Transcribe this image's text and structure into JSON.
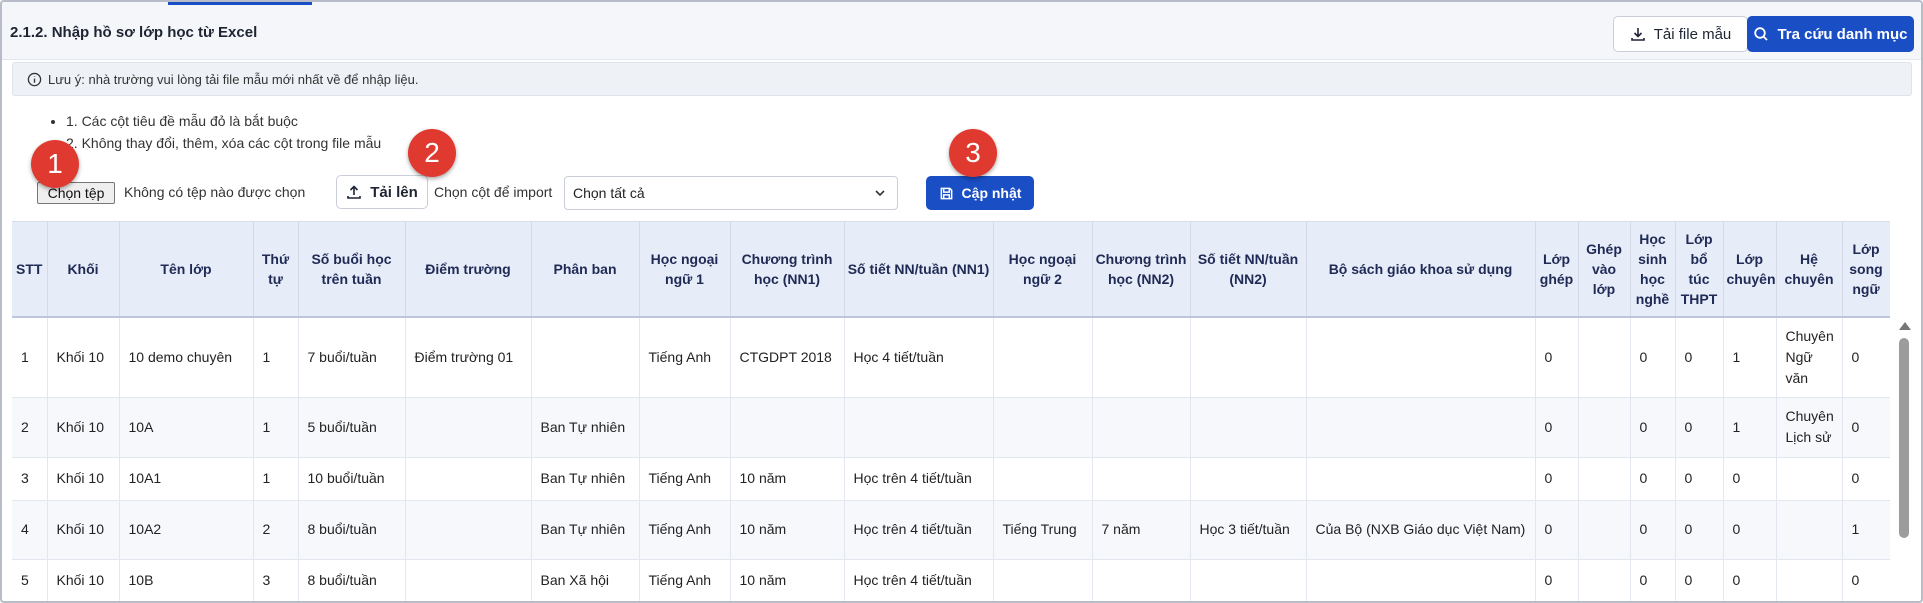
{
  "header": {
    "title": "2.1.2. Nhập hồ sơ lớp học từ Excel",
    "download_label": "Tải file mẫu",
    "lookup_label": "Tra cứu danh mục"
  },
  "note": {
    "text": "Lưu ý: nhà trường vui lòng tải file mẫu mới nhất về để nhập liệu."
  },
  "rules": [
    "1. Các cột tiêu đề mẫu đỏ là bắt buộc",
    "2. Không thay đổi, thêm, xóa các cột trong file mẫu"
  ],
  "toolbar": {
    "file_button": "Chọn tệp",
    "file_status": "Không có tệp nào được chọn",
    "upload_label": "Tải lên",
    "column_label": "Chọn cột để import",
    "column_select_value": "Chọn tất cả",
    "update_label": "Cập nhật"
  },
  "markers": [
    "1",
    "2",
    "3"
  ],
  "colors": {
    "primary": "#1a4ec4",
    "marker": "#e0392f",
    "header_bg": "#e6ecf8"
  },
  "table": {
    "headers": [
      "STT",
      "Khối",
      "Tên lớp",
      "Thứ tự",
      "Số buổi học trên tuần",
      "Điểm trường",
      "Phân ban",
      "Học ngoại ngữ 1",
      "Chương trình học (NN1)",
      "Số tiết NN/tuần (NN1)",
      "Học ngoại ngữ 2",
      "Chương trình học (NN2)",
      "Số tiết NN/tuần (NN2)",
      "Bộ sách giáo khoa sử dụng",
      "Lớp ghép",
      "Ghép vào lớp",
      "Học sinh học nghề",
      "Lớp bổ túc THPT",
      "Lớp chuyên",
      "Hệ chuyên",
      "Lớp song ngữ"
    ],
    "rows": [
      [
        "1",
        "Khối 10",
        "10 demo chuyên",
        "1",
        "7 buổi/tuần",
        "Điểm trường 01",
        "",
        "Tiếng Anh",
        "CTGDPT 2018",
        "Học 4 tiết/tuần",
        "",
        "",
        "",
        "",
        "0",
        "",
        "0",
        "0",
        "1",
        "Chuyên Ngữ văn",
        "0"
      ],
      [
        "2",
        "Khối 10",
        "10A",
        "1",
        "5 buổi/tuần",
        "",
        "Ban Tự nhiên",
        "",
        "",
        "",
        "",
        "",
        "",
        "",
        "0",
        "",
        "0",
        "0",
        "1",
        "Chuyên Lịch sử",
        "0"
      ],
      [
        "3",
        "Khối 10",
        "10A1",
        "1",
        "10 buổi/tuần",
        "",
        "Ban Tự nhiên",
        "Tiếng Anh",
        "10 năm",
        "Học trên 4 tiết/tuần",
        "",
        "",
        "",
        "",
        "0",
        "",
        "0",
        "0",
        "0",
        "",
        "0"
      ],
      [
        "4",
        "Khối 10",
        "10A2",
        "2",
        "8 buổi/tuần",
        "",
        "Ban Tự nhiên",
        "Tiếng Anh",
        "10 năm",
        "Học trên 4 tiết/tuần",
        "Tiếng Trung",
        "7 năm",
        "Học 3 tiết/tuần",
        "Của Bộ (NXB Giáo dục Việt Nam)",
        "0",
        "",
        "0",
        "0",
        "0",
        "",
        "1"
      ],
      [
        "5",
        "Khối 10",
        "10B",
        "3",
        "8 buổi/tuần",
        "",
        "Ban Xã hội",
        "Tiếng Anh",
        "10 năm",
        "Học trên 4 tiết/tuần",
        "",
        "",
        "",
        "",
        "0",
        "",
        "0",
        "0",
        "0",
        "",
        "0"
      ]
    ]
  }
}
